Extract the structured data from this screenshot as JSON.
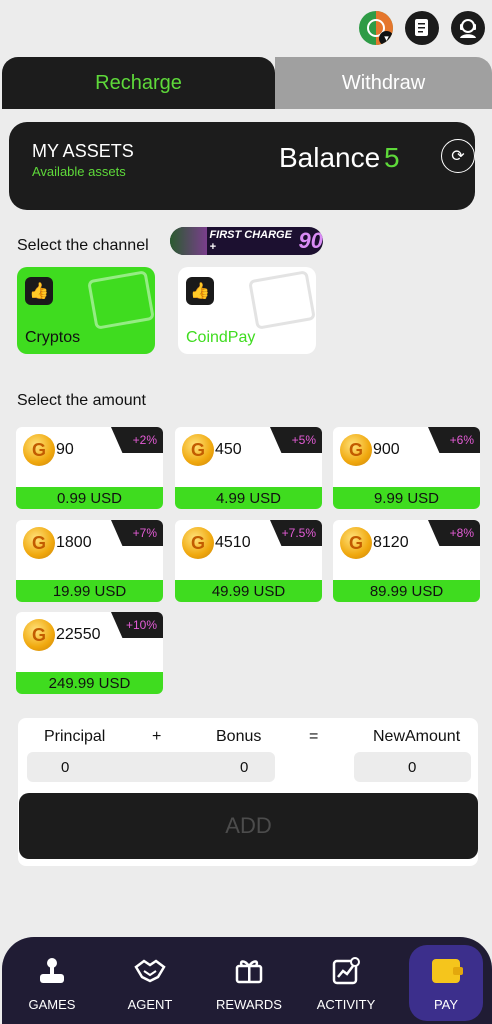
{
  "header": {
    "icons": [
      "language-flag-icon",
      "document-icon",
      "customer-service-icon"
    ]
  },
  "tabs": [
    {
      "label": "Recharge",
      "active": true
    },
    {
      "label": "Withdraw",
      "active": false
    }
  ],
  "assets": {
    "title": "MY ASSETS",
    "subtitle": "Available assets",
    "balance_label": "Balance",
    "balance_value": "5",
    "refresh_icon": "refresh-icon"
  },
  "channel": {
    "section_label": "Select the channel",
    "promo": {
      "text": "FIRST CHARGE +",
      "number": "90"
    },
    "options": [
      {
        "name": "Cryptos",
        "selected": true
      },
      {
        "name": "CoindPay",
        "selected": false
      }
    ]
  },
  "amount": {
    "section_label": "Select the amount",
    "options": [
      {
        "coins": "90",
        "bonus": "+2%",
        "price": "0.99 USD"
      },
      {
        "coins": "450",
        "bonus": "+5%",
        "price": "4.99 USD"
      },
      {
        "coins": "900",
        "bonus": "+6%",
        "price": "9.99 USD"
      },
      {
        "coins": "1800",
        "bonus": "+7%",
        "price": "19.99 USD"
      },
      {
        "coins": "4510",
        "bonus": "+7.5%",
        "price": "49.99 USD"
      },
      {
        "coins": "8120",
        "bonus": "+8%",
        "price": "89.99 USD"
      },
      {
        "coins": "22550",
        "bonus": "+10%",
        "price": "249.99 USD"
      }
    ]
  },
  "calc": {
    "principal_label": "Principal",
    "plus": "+",
    "bonus_label": "Bonus",
    "equals": "=",
    "new_amount_label": "NewAmount",
    "principal_value": "0",
    "bonus_value": "0",
    "new_amount_value": "0"
  },
  "add_button": "ADD",
  "nav": [
    {
      "label": "GAMES",
      "icon": "joystick-icon"
    },
    {
      "label": "AGENT",
      "icon": "handshake-icon"
    },
    {
      "label": "REWARDS",
      "icon": "gift-icon"
    },
    {
      "label": "ACTIVITY",
      "icon": "activity-chart-icon"
    },
    {
      "label": "PAY",
      "icon": "wallet-icon",
      "active": true
    }
  ],
  "colors": {
    "accent_green": "#3fdc1f",
    "dark": "#1c1c1c",
    "nav_bg": "#201c34",
    "bonus_pink": "#e45cd6"
  }
}
